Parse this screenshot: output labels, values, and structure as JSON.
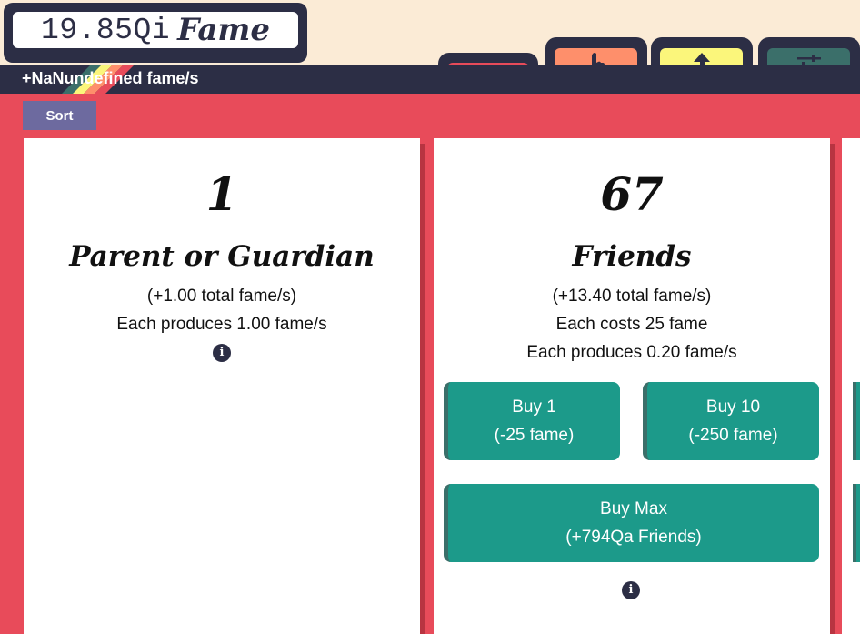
{
  "header": {
    "fame_value": "19.85Qi",
    "fame_label": "Fame",
    "rate_text": "+NaNundefined fame/s"
  },
  "tabs": [
    {
      "icon": "add-user-icon",
      "color": "#e84b5a",
      "active": true
    },
    {
      "icon": "pointer-hand-icon",
      "color": "#fe8f6b"
    },
    {
      "icon": "arrow-up-icon",
      "color": "#fbf67b"
    },
    {
      "icon": "sliders-icon",
      "color": "#3b6f6a"
    }
  ],
  "toolbar": {
    "sort_label": "Sort"
  },
  "cards": [
    {
      "count": "1",
      "name": "Parent or Guardian",
      "total": "(+1.00 total fame/s)",
      "produces": "Each produces 1.00 fame/s"
    },
    {
      "count": "67",
      "name": "Friends",
      "total": "(+13.40 total fame/s)",
      "cost": "Each costs 25 fame",
      "produces": "Each produces 0.20 fame/s",
      "buy1_line1": "Buy 1",
      "buy1_line2": "(-25 fame)",
      "buy10_line1": "Buy 10",
      "buy10_line2": "(-250 fame)",
      "buymax_line1": "Buy Max",
      "buymax_line2": "(+794Qa Friends)"
    }
  ],
  "colors": {
    "dark": "#2c2e45",
    "main_bg": "#e84b5a",
    "button": "#1c9a8a",
    "sort": "#6d6a9f"
  }
}
